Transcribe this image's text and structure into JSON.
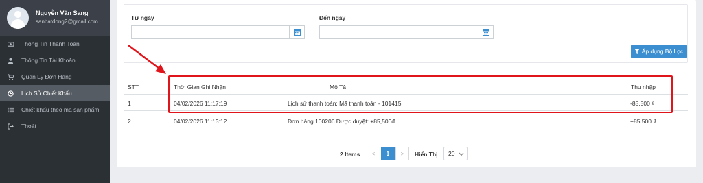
{
  "user": {
    "name": "Nguyễn Văn Sang",
    "email": "sanbatdong2@gmail.com"
  },
  "menu": [
    {
      "label": "Thông Tin Thanh Toán",
      "icon": "money-icon",
      "active": false
    },
    {
      "label": "Thông Tin Tài Khoản",
      "icon": "user-icon",
      "active": false
    },
    {
      "label": "Quản Lý Đơn Hàng",
      "icon": "cart-icon",
      "active": false
    },
    {
      "label": "Lịch Sử Chiết Khấu",
      "icon": "clock-icon",
      "active": true
    },
    {
      "label": "Chiết khấu theo mã sản phẩm",
      "icon": "list-icon",
      "active": false
    },
    {
      "label": "Thoát",
      "icon": "logout-icon",
      "active": false
    }
  ],
  "filter": {
    "from_label": "Từ ngày",
    "to_label": "Đến ngày",
    "from_value": "",
    "to_value": "",
    "apply_label": "Áp dụng Bộ Lọc"
  },
  "table": {
    "headers": {
      "stt": "STT",
      "time": "Thời Gian Ghi Nhận",
      "desc": "Mô Tả",
      "income": "Thu nhập"
    },
    "rows": [
      {
        "stt": "1",
        "time": "04/02/2026 11:17:19",
        "desc": "Lịch sử thanh toán: Mã thanh toán - 101415",
        "income": "-85,500 ₫"
      },
      {
        "stt": "2",
        "time": "04/02/2026 11:13:12",
        "desc": "Đơn hàng 100206 Được duyệt: +85,500đ",
        "income": "+85,500 ₫"
      }
    ]
  },
  "pagination": {
    "items": "2 Items",
    "prev": "<",
    "current": "1",
    "next": ">",
    "show_label": "Hiển Thị",
    "page_size": "20"
  },
  "colors": {
    "accent": "#3b8fd0",
    "sidebar": "#2b3035",
    "annotation": "#e0141b"
  }
}
